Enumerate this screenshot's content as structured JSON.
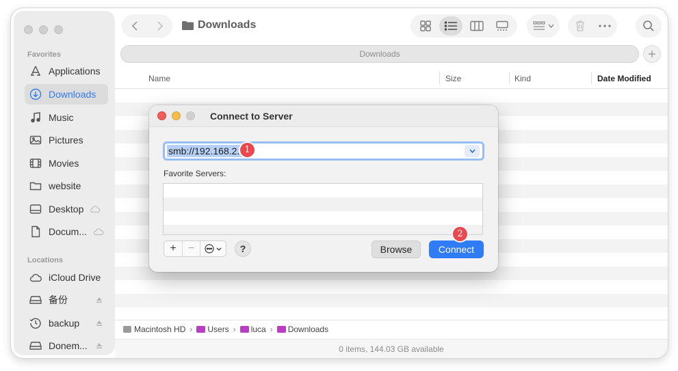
{
  "finder": {
    "title": "Downloads",
    "tab_label": "Downloads",
    "sidebar": {
      "favorites_title": "Favorites",
      "favorites": [
        {
          "label": "Applications",
          "icon": "applications-icon"
        },
        {
          "label": "Downloads",
          "icon": "downloads-icon",
          "selected": true
        },
        {
          "label": "Music",
          "icon": "music-icon"
        },
        {
          "label": "Pictures",
          "icon": "pictures-icon"
        },
        {
          "label": "Movies",
          "icon": "movies-icon"
        },
        {
          "label": "website",
          "icon": "folder-icon"
        },
        {
          "label": "Desktop",
          "icon": "desktop-icon",
          "cloud": true
        },
        {
          "label": "Docum...",
          "icon": "document-icon",
          "cloud": true
        }
      ],
      "locations_title": "Locations",
      "locations": [
        {
          "label": "iCloud Drive",
          "icon": "icloud-icon"
        },
        {
          "label": "备份",
          "icon": "drive-icon",
          "eject": true
        },
        {
          "label": "backup",
          "icon": "time-machine-icon",
          "eject": true
        },
        {
          "label": "Donem...",
          "icon": "drive-icon",
          "eject": true
        }
      ]
    },
    "columns": {
      "name": "Name",
      "size": "Size",
      "kind": "Kind",
      "date_modified": "Date Modified"
    },
    "path": {
      "root": "Macintosh HD",
      "users": "Users",
      "user": "luca",
      "folder": "Downloads"
    },
    "status": "0 items, 144.03 GB available"
  },
  "dialog": {
    "title": "Connect to Server",
    "address_value": "smb://192.168.2.1/",
    "favorite_servers_label": "Favorite Servers:",
    "add_label": "+",
    "remove_label": "−",
    "help_label": "?",
    "browse_label": "Browse",
    "connect_label": "Connect"
  },
  "markers": [
    {
      "label": "1",
      "target": "address-field"
    },
    {
      "label": "2",
      "target": "connect-button"
    }
  ],
  "colors": {
    "accent": "#2f7cf6",
    "close": "#ec5f5a",
    "minimize": "#f4bd4f",
    "zoom_inactive": "#d0d0d0",
    "marker": "#e8484e",
    "selection": "#b7d1f6"
  }
}
